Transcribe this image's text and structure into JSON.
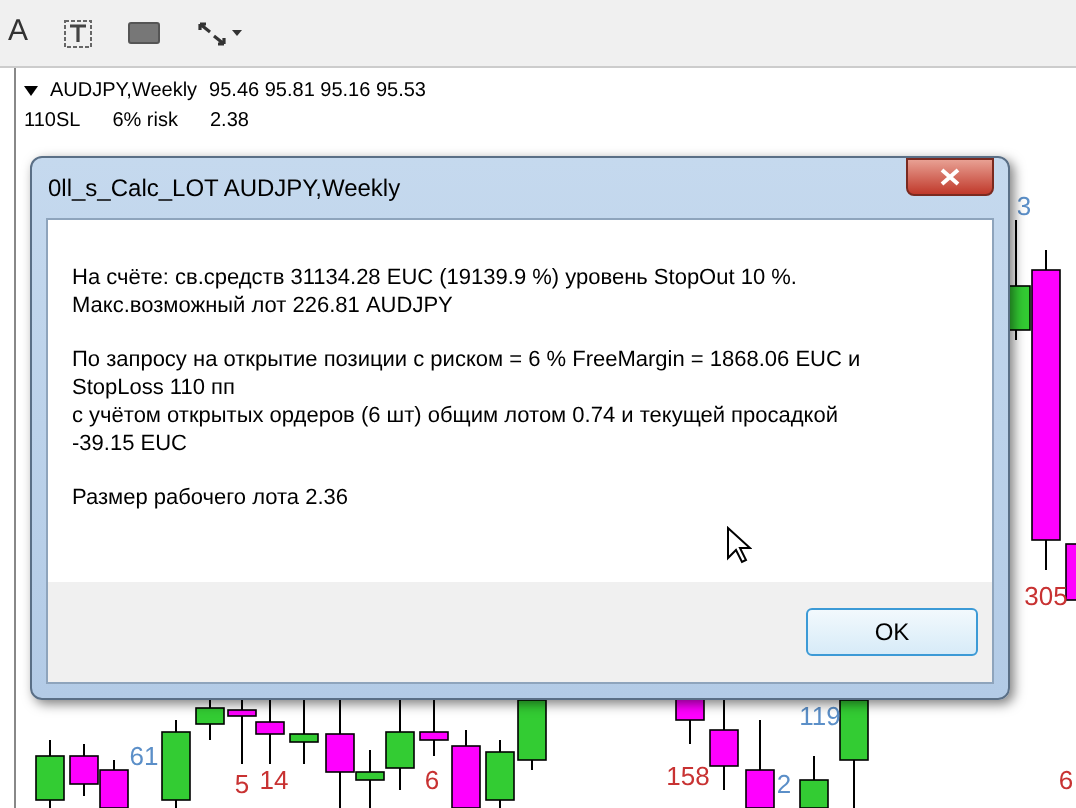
{
  "toolbar": {
    "items": [
      {
        "kind": "text",
        "label": "A"
      },
      {
        "kind": "textbox"
      },
      {
        "kind": "rect"
      },
      {
        "kind": "arrows"
      }
    ]
  },
  "chart": {
    "header": {
      "symbol": "AUDJPY,Weekly",
      "prices": "95.46 95.81 95.16 95.53",
      "line2": [
        "110SL",
        "6% risk",
        "2.38"
      ]
    },
    "labels": [
      {
        "text": "3",
        "color": "#5b8fc8"
      },
      {
        "text": "305",
        "color": "#c83232"
      },
      {
        "text": "61",
        "color": "#5b8fc8"
      },
      {
        "text": "5",
        "color": "#c83232"
      },
      {
        "text": "14",
        "color": "#c83232"
      },
      {
        "text": "6",
        "color": "#c83232"
      },
      {
        "text": "158",
        "color": "#c83232"
      },
      {
        "text": "2",
        "color": "#5b8fc8"
      },
      {
        "text": "119",
        "color": "#5b8fc8"
      },
      {
        "text": "6",
        "color": "#c83232"
      }
    ]
  },
  "dialog": {
    "title": "0ll_s_Calc_LOT AUDJPY,Weekly",
    "paragraphs": [
      [
        "На счёте: св.средств 31134.28 EUC (19139.9 %) уровень StopOut 10  %.",
        "Макс.возможный лот 226.81 AUDJPY"
      ],
      [
        "По запросу на открытие позиции с риском = 6 % FreeMargin = 1868.06 EUC и",
        "StopLoss 110 пп",
        "с учётом открытых ордеров (6 шт) общим лотом 0.74 и текущей просадкой",
        "-39.15 EUC"
      ],
      [
        "Размер рабочего лота 2.36"
      ]
    ],
    "button": "OK"
  }
}
